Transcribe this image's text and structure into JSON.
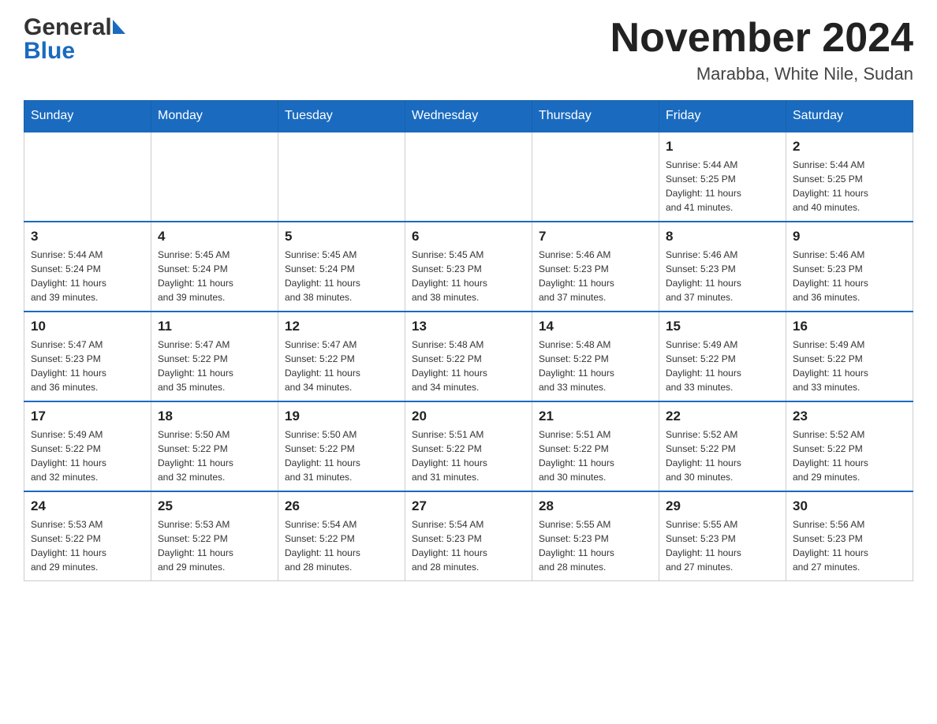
{
  "header": {
    "title": "November 2024",
    "subtitle": "Marabba, White Nile, Sudan",
    "logo_general": "General",
    "logo_blue": "Blue"
  },
  "weekdays": [
    "Sunday",
    "Monday",
    "Tuesday",
    "Wednesday",
    "Thursday",
    "Friday",
    "Saturday"
  ],
  "weeks": [
    {
      "days": [
        {
          "num": "",
          "info": ""
        },
        {
          "num": "",
          "info": ""
        },
        {
          "num": "",
          "info": ""
        },
        {
          "num": "",
          "info": ""
        },
        {
          "num": "",
          "info": ""
        },
        {
          "num": "1",
          "info": "Sunrise: 5:44 AM\nSunset: 5:25 PM\nDaylight: 11 hours\nand 41 minutes."
        },
        {
          "num": "2",
          "info": "Sunrise: 5:44 AM\nSunset: 5:25 PM\nDaylight: 11 hours\nand 40 minutes."
        }
      ]
    },
    {
      "days": [
        {
          "num": "3",
          "info": "Sunrise: 5:44 AM\nSunset: 5:24 PM\nDaylight: 11 hours\nand 39 minutes."
        },
        {
          "num": "4",
          "info": "Sunrise: 5:45 AM\nSunset: 5:24 PM\nDaylight: 11 hours\nand 39 minutes."
        },
        {
          "num": "5",
          "info": "Sunrise: 5:45 AM\nSunset: 5:24 PM\nDaylight: 11 hours\nand 38 minutes."
        },
        {
          "num": "6",
          "info": "Sunrise: 5:45 AM\nSunset: 5:23 PM\nDaylight: 11 hours\nand 38 minutes."
        },
        {
          "num": "7",
          "info": "Sunrise: 5:46 AM\nSunset: 5:23 PM\nDaylight: 11 hours\nand 37 minutes."
        },
        {
          "num": "8",
          "info": "Sunrise: 5:46 AM\nSunset: 5:23 PM\nDaylight: 11 hours\nand 37 minutes."
        },
        {
          "num": "9",
          "info": "Sunrise: 5:46 AM\nSunset: 5:23 PM\nDaylight: 11 hours\nand 36 minutes."
        }
      ]
    },
    {
      "days": [
        {
          "num": "10",
          "info": "Sunrise: 5:47 AM\nSunset: 5:23 PM\nDaylight: 11 hours\nand 36 minutes."
        },
        {
          "num": "11",
          "info": "Sunrise: 5:47 AM\nSunset: 5:22 PM\nDaylight: 11 hours\nand 35 minutes."
        },
        {
          "num": "12",
          "info": "Sunrise: 5:47 AM\nSunset: 5:22 PM\nDaylight: 11 hours\nand 34 minutes."
        },
        {
          "num": "13",
          "info": "Sunrise: 5:48 AM\nSunset: 5:22 PM\nDaylight: 11 hours\nand 34 minutes."
        },
        {
          "num": "14",
          "info": "Sunrise: 5:48 AM\nSunset: 5:22 PM\nDaylight: 11 hours\nand 33 minutes."
        },
        {
          "num": "15",
          "info": "Sunrise: 5:49 AM\nSunset: 5:22 PM\nDaylight: 11 hours\nand 33 minutes."
        },
        {
          "num": "16",
          "info": "Sunrise: 5:49 AM\nSunset: 5:22 PM\nDaylight: 11 hours\nand 33 minutes."
        }
      ]
    },
    {
      "days": [
        {
          "num": "17",
          "info": "Sunrise: 5:49 AM\nSunset: 5:22 PM\nDaylight: 11 hours\nand 32 minutes."
        },
        {
          "num": "18",
          "info": "Sunrise: 5:50 AM\nSunset: 5:22 PM\nDaylight: 11 hours\nand 32 minutes."
        },
        {
          "num": "19",
          "info": "Sunrise: 5:50 AM\nSunset: 5:22 PM\nDaylight: 11 hours\nand 31 minutes."
        },
        {
          "num": "20",
          "info": "Sunrise: 5:51 AM\nSunset: 5:22 PM\nDaylight: 11 hours\nand 31 minutes."
        },
        {
          "num": "21",
          "info": "Sunrise: 5:51 AM\nSunset: 5:22 PM\nDaylight: 11 hours\nand 30 minutes."
        },
        {
          "num": "22",
          "info": "Sunrise: 5:52 AM\nSunset: 5:22 PM\nDaylight: 11 hours\nand 30 minutes."
        },
        {
          "num": "23",
          "info": "Sunrise: 5:52 AM\nSunset: 5:22 PM\nDaylight: 11 hours\nand 29 minutes."
        }
      ]
    },
    {
      "days": [
        {
          "num": "24",
          "info": "Sunrise: 5:53 AM\nSunset: 5:22 PM\nDaylight: 11 hours\nand 29 minutes."
        },
        {
          "num": "25",
          "info": "Sunrise: 5:53 AM\nSunset: 5:22 PM\nDaylight: 11 hours\nand 29 minutes."
        },
        {
          "num": "26",
          "info": "Sunrise: 5:54 AM\nSunset: 5:22 PM\nDaylight: 11 hours\nand 28 minutes."
        },
        {
          "num": "27",
          "info": "Sunrise: 5:54 AM\nSunset: 5:23 PM\nDaylight: 11 hours\nand 28 minutes."
        },
        {
          "num": "28",
          "info": "Sunrise: 5:55 AM\nSunset: 5:23 PM\nDaylight: 11 hours\nand 28 minutes."
        },
        {
          "num": "29",
          "info": "Sunrise: 5:55 AM\nSunset: 5:23 PM\nDaylight: 11 hours\nand 27 minutes."
        },
        {
          "num": "30",
          "info": "Sunrise: 5:56 AM\nSunset: 5:23 PM\nDaylight: 11 hours\nand 27 minutes."
        }
      ]
    }
  ]
}
